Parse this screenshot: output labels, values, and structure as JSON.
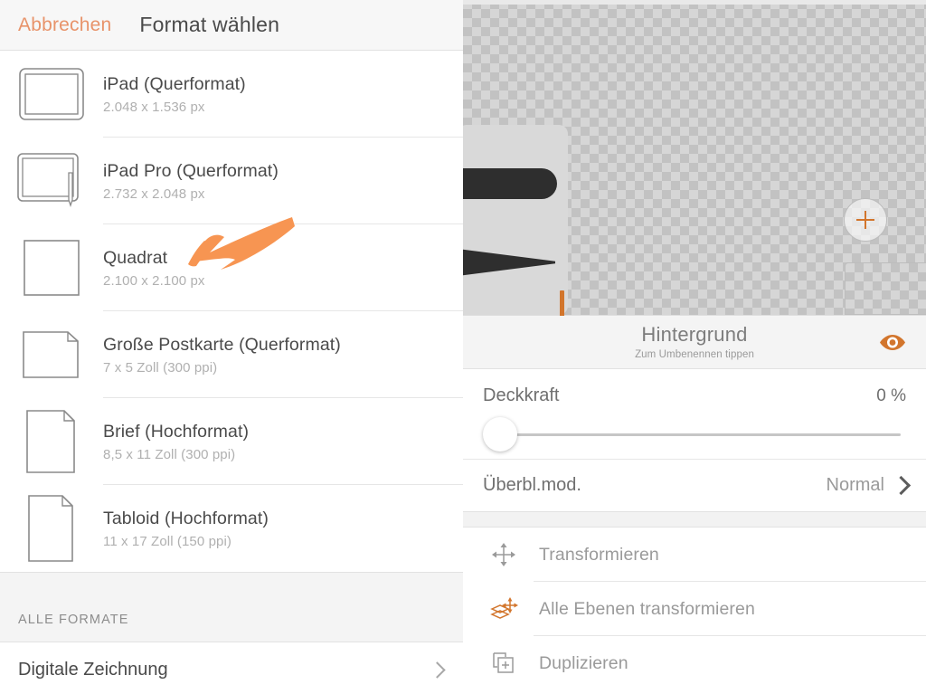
{
  "left": {
    "header": {
      "cancel_label": "Abbrechen",
      "title": "Format wählen"
    },
    "formats": [
      {
        "icon": "ipad-landscape-icon",
        "name": "iPad (Querformat)",
        "sub": "2.048 x 1.536 px"
      },
      {
        "icon": "ipad-pro-landscape-icon",
        "name": "iPad Pro (Querformat)",
        "sub": "2.732 x 2.048 px"
      },
      {
        "icon": "square-icon",
        "name": "Quadrat",
        "sub": "2.100 x 2.100 px"
      },
      {
        "icon": "postcard-landscape-icon",
        "name": "Große Postkarte (Querformat)",
        "sub": "7 x 5 Zoll  (300 ppi)"
      },
      {
        "icon": "letter-portrait-icon",
        "name": "Brief (Hochformat)",
        "sub": "8,5 x 11 Zoll  (300 ppi)"
      },
      {
        "icon": "tabloid-portrait-icon",
        "name": "Tabloid (Hochformat)",
        "sub": "11 x 17 Zoll  (150 ppi)"
      }
    ],
    "section": {
      "heading": "ALLE FORMATE",
      "item_label": "Digitale Zeichnung"
    }
  },
  "right": {
    "canvas": {
      "add_layer_icon": "plus-icon",
      "layer_thumbnail": "layer-thumbnail"
    },
    "layer": {
      "name": "Hintergrund",
      "rename_hint": "Zum Umbenennen tippen",
      "visibility_icon": "eye-icon"
    },
    "opacity": {
      "label": "Deckkraft",
      "value": "0 %",
      "percent": 0
    },
    "blend": {
      "label": "Überbl.mod.",
      "value": "Normal"
    },
    "actions": [
      {
        "icon": "move-arrows-icon",
        "label": "Transformieren"
      },
      {
        "icon": "transform-all-layers-icon",
        "label": "Alle Ebenen transformieren"
      },
      {
        "icon": "duplicate-icon",
        "label": "Duplizieren"
      }
    ]
  },
  "colors": {
    "accent_orange": "#F79552",
    "cancel_orange": "#e8936a",
    "icon_orange": "#d2752c",
    "text_dark": "#4a4a4a",
    "text_muted": "#9a9a9a",
    "divider": "#e6e6e6"
  }
}
